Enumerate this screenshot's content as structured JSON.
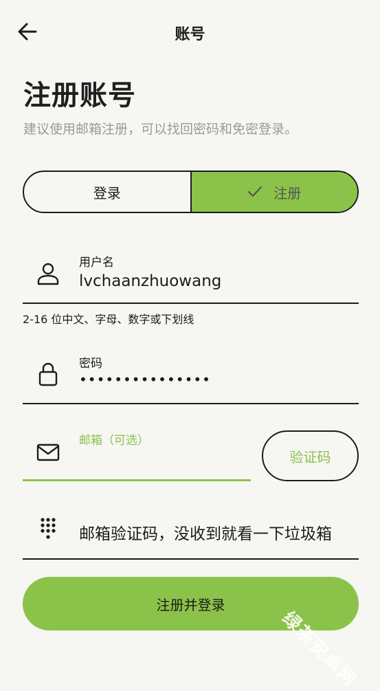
{
  "header": {
    "title": "账号",
    "back_icon": "arrow-left-icon"
  },
  "page": {
    "heading": "注册账号",
    "subtitle": "建议使用邮箱注册，可以找回密码和免密登录。"
  },
  "segmented": {
    "login_label": "登录",
    "register_label": "注册",
    "selected": "register",
    "check_icon": "check-icon"
  },
  "username": {
    "label": "用户名",
    "value": "lvchaanzhuowang",
    "icon": "person-icon",
    "hint": "2-16 位中文、字母、数字或下划线"
  },
  "password": {
    "label": "密码",
    "value": "•••••••••••••••",
    "icon": "lock-icon"
  },
  "email": {
    "label": "邮箱（可选）",
    "value": "",
    "icon": "mail-icon",
    "verify_label": "验证码"
  },
  "code": {
    "placeholder": "邮箱验证码，没收到就看一下垃圾箱",
    "icon": "dialpad-icon"
  },
  "submit_label": "注册并登录",
  "watermark": "绿茶安卓网",
  "colors": {
    "accent": "#8bc34a",
    "background": "#f6f6f3",
    "text": "#1b1b1b",
    "muted": "#9a9a9a"
  }
}
